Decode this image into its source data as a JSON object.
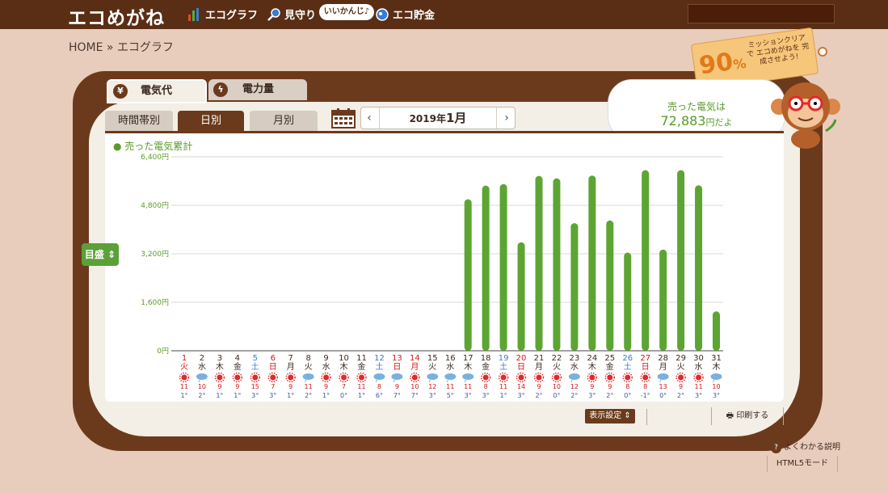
{
  "header": {
    "logo": "エコめがね",
    "nav": [
      {
        "label": "エコグラフ",
        "icon": "bar-chart-icon"
      },
      {
        "label": "見守り",
        "icon": "magnifier-icon"
      },
      {
        "label": "エコ貯金",
        "icon": "piggy-bank-icon"
      }
    ],
    "bubble": "いいかんじ♪"
  },
  "breadcrumb": "HOME » エコグラフ",
  "main_tabs": [
    {
      "label": "電気代",
      "icon": "yen-icon",
      "active": true
    },
    {
      "label": "電力量",
      "icon": "lightning-icon",
      "active": false
    }
  ],
  "sub_tabs": [
    {
      "label": "時間帯別",
      "active": false
    },
    {
      "label": "日別",
      "active": true
    },
    {
      "label": "月別",
      "active": false
    }
  ],
  "date": {
    "year_label": "2019年",
    "month_label": "1月",
    "prev": "‹",
    "next": "›"
  },
  "mission": {
    "percent": "90",
    "unit": "%",
    "message": "ミッションクリアで エコめがねを 完成させよう!"
  },
  "speech": {
    "line1": "売った電気は",
    "amount": "72,883",
    "suffix": "円だよ"
  },
  "side_button": "目盛",
  "bottom": {
    "display_settings": "表示設定",
    "print": "印刷する",
    "help": "よくわかる説明",
    "html5": "HTML5モード"
  },
  "colors": {
    "bar": "#5ca532",
    "brown": "#6b3a1c",
    "saturday": "#3a7cd0",
    "sunday": "#d01818",
    "weekday": "#3b2a20"
  },
  "chart_data": {
    "type": "bar",
    "legend": "売った電気累計",
    "y_ticks": [
      "6,400円",
      "4,800円",
      "3,200円",
      "1,600円",
      "0円"
    ],
    "ylim": [
      0,
      6400
    ],
    "days": [
      {
        "d": "1",
        "w": "火",
        "wx": "sun",
        "hi": "11",
        "lo": "1",
        "holiday": true
      },
      {
        "d": "2",
        "w": "水",
        "wx": "cloud",
        "hi": "10",
        "lo": "2"
      },
      {
        "d": "3",
        "w": "木",
        "wx": "sun",
        "hi": "9",
        "lo": "1"
      },
      {
        "d": "4",
        "w": "金",
        "wx": "sun",
        "hi": "9",
        "lo": "1"
      },
      {
        "d": "5",
        "w": "土",
        "wx": "sun",
        "hi": "15",
        "lo": "3"
      },
      {
        "d": "6",
        "w": "日",
        "wx": "sun",
        "hi": "7",
        "lo": "3"
      },
      {
        "d": "7",
        "w": "月",
        "wx": "sun",
        "hi": "9",
        "lo": "1"
      },
      {
        "d": "8",
        "w": "火",
        "wx": "cloud",
        "hi": "11",
        "lo": "2"
      },
      {
        "d": "9",
        "w": "水",
        "wx": "sun",
        "hi": "9",
        "lo": "1"
      },
      {
        "d": "10",
        "w": "木",
        "wx": "sun",
        "hi": "7",
        "lo": "0"
      },
      {
        "d": "11",
        "w": "金",
        "wx": "sun",
        "hi": "11",
        "lo": "1"
      },
      {
        "d": "12",
        "w": "土",
        "wx": "cloud",
        "hi": "8",
        "lo": "6"
      },
      {
        "d": "13",
        "w": "日",
        "wx": "cloud",
        "hi": "9",
        "lo": "7"
      },
      {
        "d": "14",
        "w": "月",
        "wx": "sun",
        "hi": "10",
        "lo": "7",
        "holiday": true
      },
      {
        "d": "15",
        "w": "火",
        "wx": "cloud",
        "hi": "12",
        "lo": "3"
      },
      {
        "d": "16",
        "w": "水",
        "wx": "cloud",
        "hi": "11",
        "lo": "5"
      },
      {
        "d": "17",
        "w": "木",
        "wx": "cloud",
        "hi": "11",
        "lo": "3"
      },
      {
        "d": "18",
        "w": "金",
        "wx": "sun",
        "hi": "8",
        "lo": "3"
      },
      {
        "d": "19",
        "w": "土",
        "wx": "sun",
        "hi": "11",
        "lo": "1"
      },
      {
        "d": "20",
        "w": "日",
        "wx": "sun",
        "hi": "14",
        "lo": "3"
      },
      {
        "d": "21",
        "w": "月",
        "wx": "sun",
        "hi": "9",
        "lo": "2"
      },
      {
        "d": "22",
        "w": "火",
        "wx": "sun",
        "hi": "10",
        "lo": "0"
      },
      {
        "d": "23",
        "w": "水",
        "wx": "cloud",
        "hi": "12",
        "lo": "2"
      },
      {
        "d": "24",
        "w": "木",
        "wx": "sun",
        "hi": "9",
        "lo": "3"
      },
      {
        "d": "25",
        "w": "金",
        "wx": "sun",
        "hi": "9",
        "lo": "2"
      },
      {
        "d": "26",
        "w": "土",
        "wx": "sun",
        "hi": "8",
        "lo": "0"
      },
      {
        "d": "27",
        "w": "日",
        "wx": "sun",
        "hi": "8",
        "lo": "-1"
      },
      {
        "d": "28",
        "w": "月",
        "wx": "cloud",
        "hi": "13",
        "lo": "0"
      },
      {
        "d": "29",
        "w": "火",
        "wx": "sun",
        "hi": "9",
        "lo": "2"
      },
      {
        "d": "30",
        "w": "水",
        "wx": "sun",
        "hi": "11",
        "lo": "3"
      },
      {
        "d": "31",
        "w": "木",
        "wx": "cloud",
        "hi": "10",
        "lo": "3"
      }
    ],
    "values": [
      0,
      0,
      0,
      0,
      0,
      0,
      0,
      0,
      0,
      0,
      0,
      0,
      0,
      0,
      0,
      0,
      5000,
      5450,
      5500,
      3580,
      5770,
      5690,
      4210,
      5780,
      4300,
      3240,
      5960,
      3340,
      5960,
      5460,
      1300
    ]
  }
}
